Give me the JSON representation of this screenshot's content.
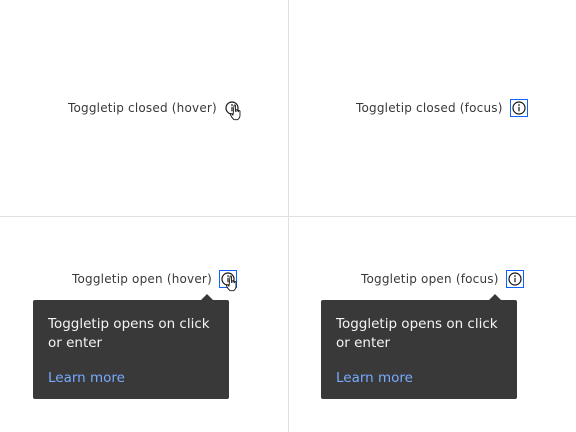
{
  "quadrants": {
    "closed_hover": {
      "label": "Toggletip closed (hover)",
      "icon": "info-icon"
    },
    "closed_focus": {
      "label": "Toggletip closed (focus)",
      "icon": "info-icon"
    },
    "open_hover": {
      "label": "Toggletip open (hover)",
      "icon": "info-icon",
      "tooltip": {
        "text": "Toggletip opens on click or enter",
        "link": "Learn more"
      }
    },
    "open_focus": {
      "label": "Toggletip open (focus)",
      "icon": "info-icon",
      "tooltip": {
        "text": "Toggletip opens on click or enter",
        "link": "Learn more"
      }
    }
  },
  "colors": {
    "focus_border": "#0f62fe",
    "tooltip_bg": "#393939",
    "tooltip_text": "#f4f4f4",
    "link": "#78a9ff",
    "divider": "#e0e0e0"
  }
}
